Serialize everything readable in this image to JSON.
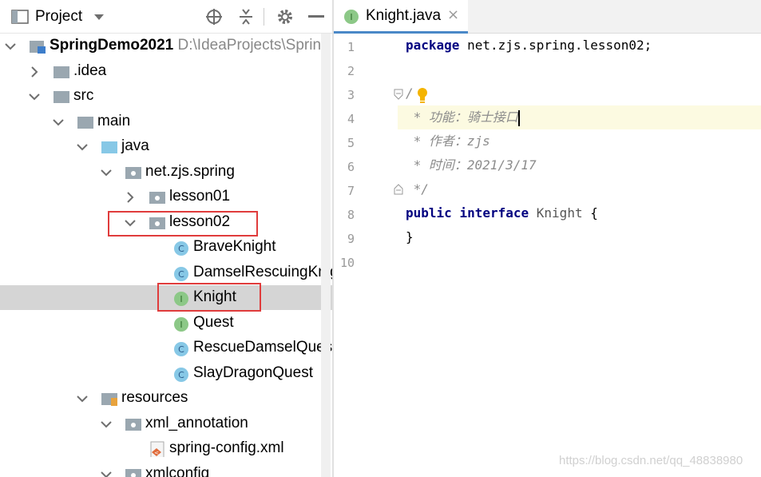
{
  "project_panel": {
    "title": "Project",
    "tree": [
      {
        "label": "SpringDemo2021",
        "path": "D:\\IdeaProjects\\Spring",
        "type": "module",
        "expanded": true
      },
      {
        "label": ".idea",
        "type": "folder",
        "expanded": false
      },
      {
        "label": "src",
        "type": "folder",
        "expanded": true
      },
      {
        "label": "main",
        "type": "folder",
        "expanded": true
      },
      {
        "label": "java",
        "type": "source-folder",
        "expanded": true
      },
      {
        "label": "net.zjs.spring",
        "type": "package",
        "expanded": true
      },
      {
        "label": "lesson01",
        "type": "package",
        "expanded": false
      },
      {
        "label": "lesson02",
        "type": "package",
        "expanded": true
      },
      {
        "label": "BraveKnight",
        "type": "class"
      },
      {
        "label": "DamselRescuingKnig",
        "type": "class"
      },
      {
        "label": "Knight",
        "type": "interface",
        "selected": true
      },
      {
        "label": "Quest",
        "type": "interface"
      },
      {
        "label": "RescueDamselQuest",
        "type": "class"
      },
      {
        "label": "SlayDragonQuest",
        "type": "class"
      },
      {
        "label": "resources",
        "type": "resources-folder",
        "expanded": true
      },
      {
        "label": "xml_annotation",
        "type": "package",
        "expanded": true
      },
      {
        "label": "spring-config.xml",
        "type": "xml-file"
      },
      {
        "label": "xmlconfig",
        "type": "package",
        "expanded": true
      }
    ]
  },
  "editor": {
    "tab_label": "Knight.java",
    "tab_close": "×",
    "line_numbers": [
      "1",
      "2",
      "3",
      "4",
      "5",
      "6",
      "7",
      "8",
      "9",
      "10"
    ],
    "code": {
      "l1_kw": "package",
      "l1_rest": " net.zjs.spring.lesson02;",
      "l3": "/",
      "l4": " * 功能：骑士接口",
      "l5": " * 作者：zjs",
      "l6": " * 时间：2021/3/17",
      "l7": " */",
      "l8_kw1": "public",
      "l8_kw2": "interface",
      "l8_name": "Knight",
      "l8_brace": "{",
      "l9": "}"
    }
  },
  "watermark": "https://blog.csdn.net/qq_48838980",
  "colors": {
    "selection": "#d5d5d5",
    "highlight_box": "#e03c3c",
    "keyword": "#000080",
    "comment": "#8c8c8c",
    "current_line": "#fcfae1",
    "tab_underline": "#4a88c7"
  }
}
